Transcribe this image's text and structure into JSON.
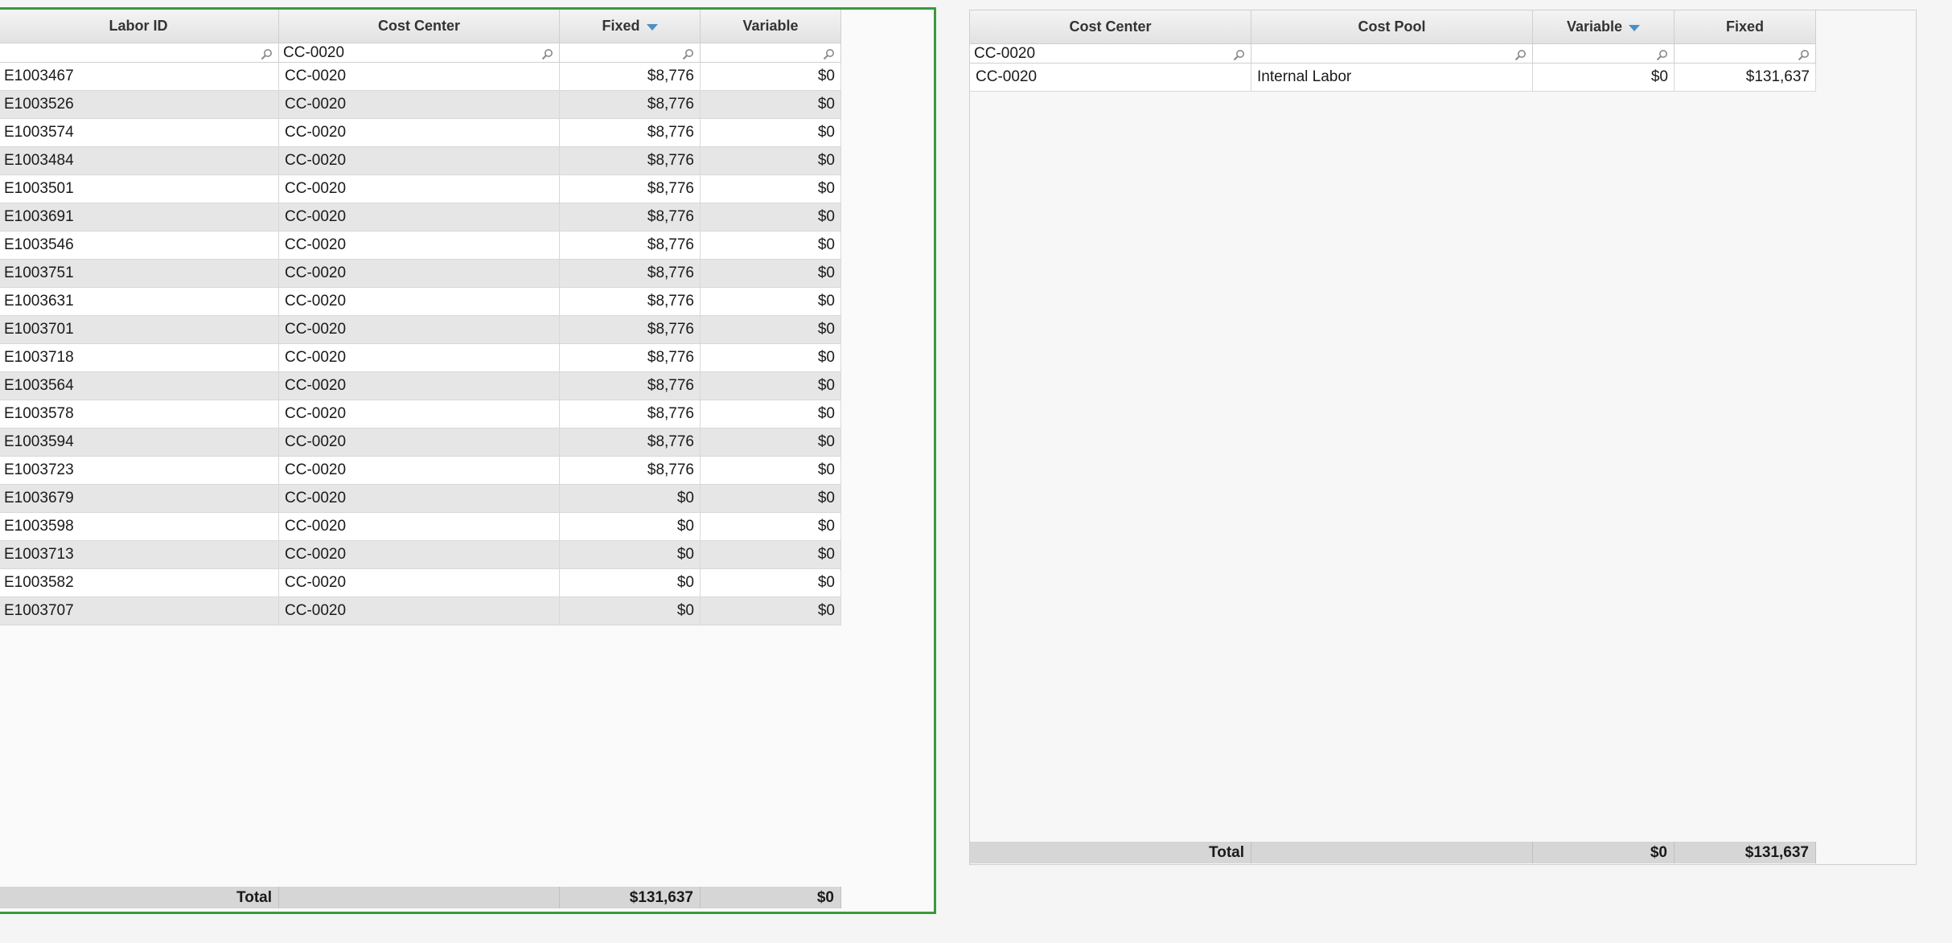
{
  "left_grid": {
    "columns": [
      {
        "label": "Labor ID",
        "sorted": false
      },
      {
        "label": "Cost Center",
        "sorted": false
      },
      {
        "label": "Fixed",
        "sorted": true
      },
      {
        "label": "Variable",
        "sorted": false
      }
    ],
    "filters": [
      "",
      "CC-0020",
      "",
      ""
    ],
    "rows": [
      [
        "E1003467",
        "CC-0020",
        "$8,776",
        "$0"
      ],
      [
        "E1003526",
        "CC-0020",
        "$8,776",
        "$0"
      ],
      [
        "E1003574",
        "CC-0020",
        "$8,776",
        "$0"
      ],
      [
        "E1003484",
        "CC-0020",
        "$8,776",
        "$0"
      ],
      [
        "E1003501",
        "CC-0020",
        "$8,776",
        "$0"
      ],
      [
        "E1003691",
        "CC-0020",
        "$8,776",
        "$0"
      ],
      [
        "E1003546",
        "CC-0020",
        "$8,776",
        "$0"
      ],
      [
        "E1003751",
        "CC-0020",
        "$8,776",
        "$0"
      ],
      [
        "E1003631",
        "CC-0020",
        "$8,776",
        "$0"
      ],
      [
        "E1003701",
        "CC-0020",
        "$8,776",
        "$0"
      ],
      [
        "E1003718",
        "CC-0020",
        "$8,776",
        "$0"
      ],
      [
        "E1003564",
        "CC-0020",
        "$8,776",
        "$0"
      ],
      [
        "E1003578",
        "CC-0020",
        "$8,776",
        "$0"
      ],
      [
        "E1003594",
        "CC-0020",
        "$8,776",
        "$0"
      ],
      [
        "E1003723",
        "CC-0020",
        "$8,776",
        "$0"
      ],
      [
        "E1003679",
        "CC-0020",
        "$0",
        "$0"
      ],
      [
        "E1003598",
        "CC-0020",
        "$0",
        "$0"
      ],
      [
        "E1003713",
        "CC-0020",
        "$0",
        "$0"
      ],
      [
        "E1003582",
        "CC-0020",
        "$0",
        "$0"
      ],
      [
        "E1003707",
        "CC-0020",
        "$0",
        "$0"
      ]
    ],
    "total": [
      "Total",
      "",
      "$131,637",
      "$0"
    ]
  },
  "right_grid": {
    "columns": [
      {
        "label": "Cost Center",
        "sorted": false
      },
      {
        "label": "Cost Pool",
        "sorted": false
      },
      {
        "label": "Variable",
        "sorted": true
      },
      {
        "label": "Fixed",
        "sorted": false
      }
    ],
    "filters": [
      "CC-0020",
      "",
      "",
      ""
    ],
    "rows": [
      [
        "CC-0020",
        "Internal Labor",
        "$0",
        "$131,637"
      ]
    ],
    "total": [
      "Total",
      "",
      "$0",
      "$131,637"
    ]
  },
  "colors": {
    "active_panel_border": "#3a9a3a",
    "sort_indicator": "#4a90c8",
    "row_alt": "#e6e6e6",
    "total_bg": "#d6d6d6"
  },
  "icons": {
    "filter": "search-icon",
    "sort": "sort-descending-icon"
  }
}
